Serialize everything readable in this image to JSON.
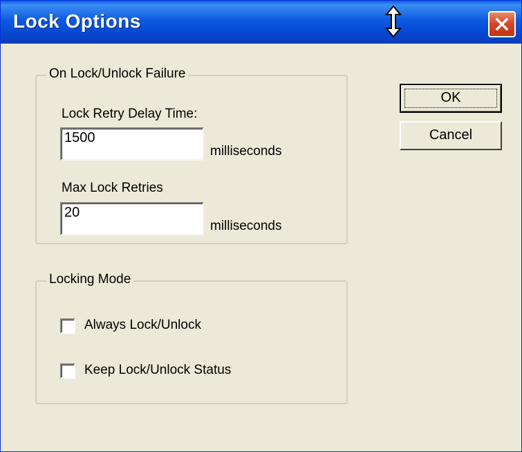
{
  "window": {
    "title": "Lock Options"
  },
  "failure_group": {
    "legend": "On Lock/Unlock Failure",
    "retry_delay": {
      "label": "Lock Retry Delay Time:",
      "value": "1500",
      "unit": "milliseconds"
    },
    "max_retries": {
      "label": "Max Lock Retries",
      "value": "20",
      "unit": "milliseconds"
    }
  },
  "mode_group": {
    "legend": "Locking Mode",
    "options": [
      {
        "label": "Always Lock/Unlock",
        "checked": false
      },
      {
        "label": "Keep Lock/Unlock Status",
        "checked": false
      }
    ]
  },
  "buttons": {
    "ok_label": "OK",
    "cancel_label": "Cancel"
  },
  "colors": {
    "titlebar": "#0a5fe6",
    "dialog_bg": "#ece9d8",
    "close_button": "#d6452a"
  },
  "icons": {
    "cursor": "resize-vertical-cursor-icon",
    "close": "close-icon"
  }
}
